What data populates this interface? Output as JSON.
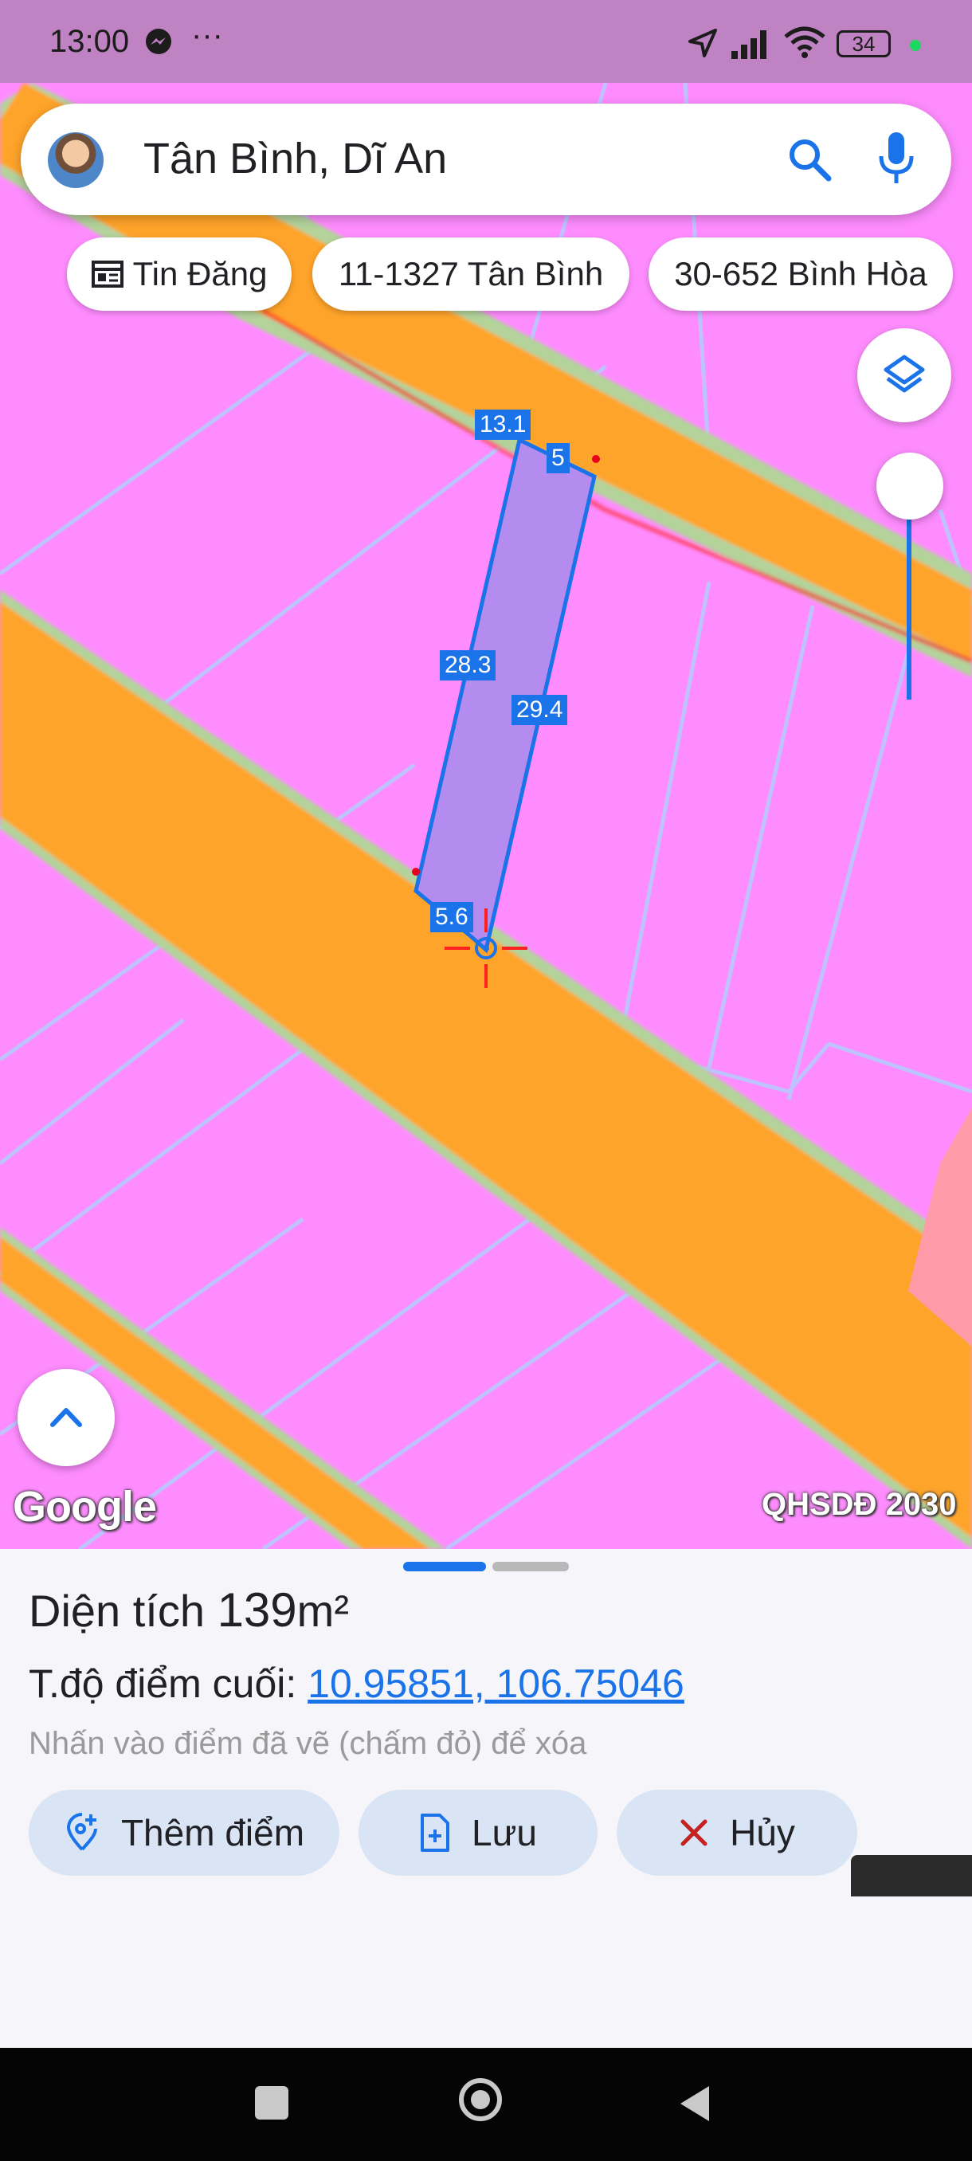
{
  "status_bar": {
    "time": "13:00",
    "battery": "34",
    "overflow": "···"
  },
  "search": {
    "text": "Tân Bình, Dĩ An"
  },
  "chips": [
    {
      "label": "Tin Đăng",
      "icon": "newspaper-icon"
    },
    {
      "label": "11-1327 Tân Bình"
    },
    {
      "label": "30-652 Bình Hòa"
    }
  ],
  "map": {
    "segment_labels": [
      "13.1",
      "5",
      "28.3",
      "29.4",
      "5.6"
    ],
    "google_logo": "Google",
    "plan_label": "QHSDĐ 2030",
    "colors": {
      "zone_residential": "#ff8cff",
      "zone_road": "#ffa42b",
      "parcel_fill": "#b48cf0",
      "parcel_stroke": "#1a73e8"
    }
  },
  "sheet": {
    "area_prefix": "Diện tích ",
    "area_value": "139",
    "area_unit": "m²",
    "coord_prefix": "T.độ điểm cuối: ",
    "coord_value": "10.95851, 106.75046",
    "hint": "Nhấn vào điểm đã vẽ (chấm đỏ) để xóa",
    "buttons": {
      "add_point": "Thêm điểm",
      "save": "Lưu",
      "cancel": "Hủy"
    }
  },
  "accent_color": "#1a73e8"
}
